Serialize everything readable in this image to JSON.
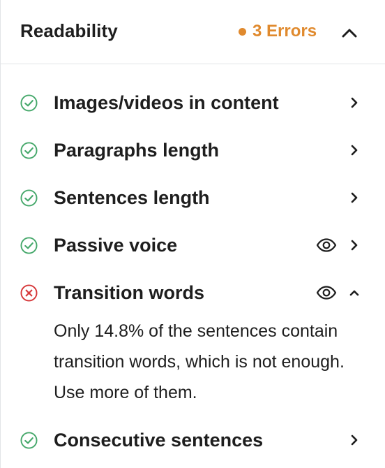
{
  "header": {
    "title": "Readability",
    "error_count_label": "3 Errors",
    "error_color": "#e08a2e",
    "toggle_icon": "chevron-up-icon"
  },
  "colors": {
    "good": "#46a86b",
    "bad": "#d63638",
    "text": "#1e1e1e",
    "icon": "#1e1e1e",
    "divider": "#e2e4e7"
  },
  "items": [
    {
      "label": "Images/videos in content",
      "status": "good",
      "has_eye": false,
      "expanded": false
    },
    {
      "label": "Paragraphs length",
      "status": "good",
      "has_eye": false,
      "expanded": false
    },
    {
      "label": "Sentences length",
      "status": "good",
      "has_eye": false,
      "expanded": false
    },
    {
      "label": "Passive voice",
      "status": "good",
      "has_eye": true,
      "expanded": false
    },
    {
      "label": "Transition words",
      "status": "bad",
      "has_eye": true,
      "expanded": true,
      "description": "Only 14.8% of the sentences contain transition words, which is not enough. Use more of them."
    },
    {
      "label": "Consecutive sentences",
      "status": "good",
      "has_eye": false,
      "expanded": false
    }
  ]
}
